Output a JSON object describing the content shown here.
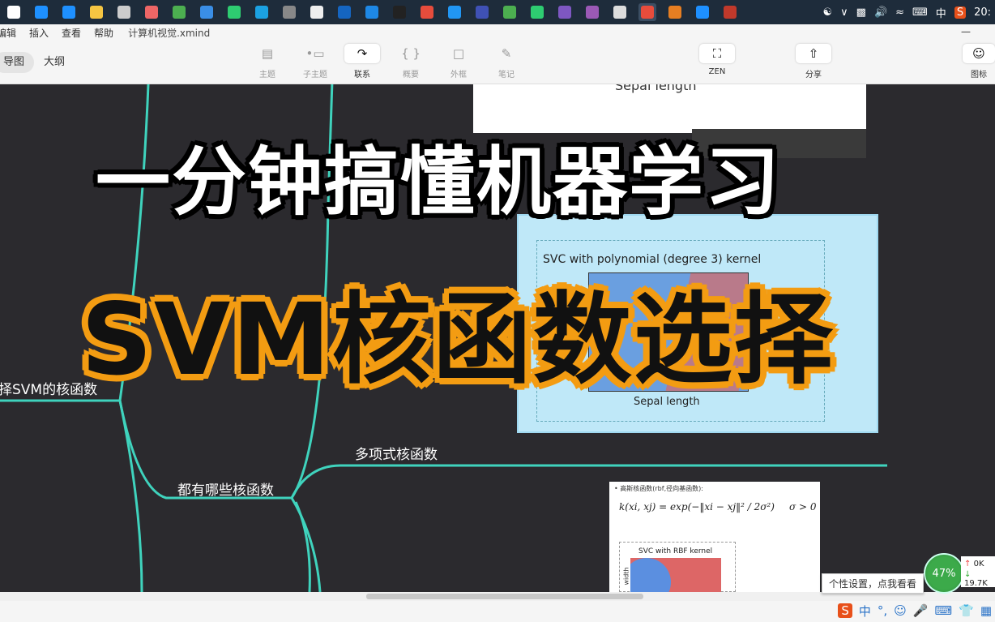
{
  "taskbar": {
    "icons": [
      "task-view-icon",
      "ie-icon",
      "edge-icon",
      "explorer-icon",
      "store-icon",
      "app-icon",
      "chrome-icon",
      "app-icon",
      "wechat-icon",
      "jetbrains-icon",
      "app-icon",
      "app-icon",
      "outlook-icon",
      "vscode-icon",
      "code-icon",
      "qq-icon",
      "app-icon",
      "app-icon",
      "app-icon",
      "app-icon",
      "app-icon",
      "visualstudio-icon",
      "settings-icon",
      "xmind-icon",
      "app-icon",
      "ie-icon",
      "mcafee-icon"
    ],
    "tray": {
      "ime": "中",
      "time": "20:"
    }
  },
  "menubar": {
    "items": [
      "编辑",
      "插入",
      "查看",
      "帮助"
    ],
    "file_name": "计算机视觉.xmind",
    "minimize": "—"
  },
  "toolbar": {
    "view_tabs": [
      "导图",
      "大纲"
    ],
    "tools": [
      {
        "label": "主题",
        "icon": "topic-icon"
      },
      {
        "label": "子主题",
        "icon": "subtopic-icon"
      },
      {
        "label": "联系",
        "icon": "relationship-icon"
      },
      {
        "label": "概要",
        "icon": "summary-icon"
      },
      {
        "label": "外框",
        "icon": "boundary-icon"
      },
      {
        "label": "笔记",
        "icon": "note-icon"
      }
    ],
    "zen_label": "ZEN",
    "share_label": "分享",
    "icon_label": "图标"
  },
  "canvas": {
    "node_left": "择SVM的核函数",
    "node_middle": "都有哪些核函数",
    "node_poly": "多项式核函数",
    "top_card_caption": "Sepal length",
    "poly_card": {
      "title": "SVC with polynomial (degree 3) kernel",
      "xlabel": "Sepal length"
    },
    "rbf_card": {
      "note": "• 高斯核函数(rbf,径向基函数):",
      "formula_left": "k(x",
      "formula": "k(xi, xj) = exp(−‖xi − xj‖² / 2σ²)",
      "condition": "σ > 0",
      "plot_title": "SVC with RBF kernel",
      "ylabel": "width"
    }
  },
  "overlay": {
    "line1": "一分钟搞懂机器学习",
    "line2": "SVM核函数选择"
  },
  "system": {
    "tooltip": "个性设置，点我看看",
    "gauge": "47%",
    "net_up": "0K",
    "net_down": "19.7K",
    "ime_items": [
      "中",
      "°,",
      "☺",
      "🎤",
      "⌨",
      "👕",
      "▦"
    ]
  }
}
